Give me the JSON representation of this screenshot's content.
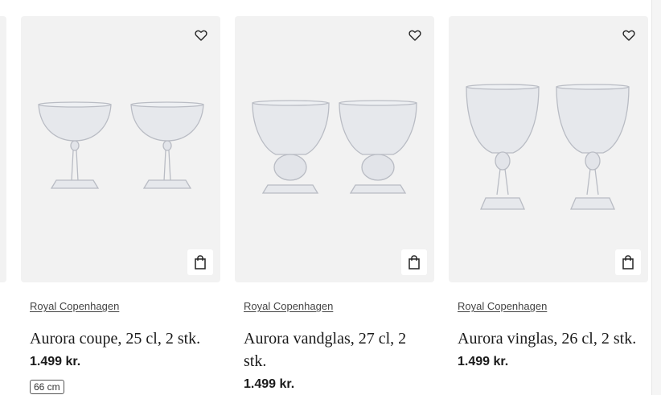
{
  "products": [
    {
      "brand": "Royal Copenhagen",
      "title": "Aurora coupe, 25 cl, 2 stk.",
      "price": "1.499 kr.",
      "size_tag": "66 cm",
      "image_icon": "coupe-glasses-image",
      "favorite_icon": "heart-icon",
      "cart_icon": "shopping-bag-icon"
    },
    {
      "brand": "Royal Copenhagen",
      "title": "Aurora vandglas, 27 cl, 2 stk.",
      "price": "1.499 kr.",
      "image_icon": "water-glasses-image",
      "favorite_icon": "heart-icon",
      "cart_icon": "shopping-bag-icon"
    },
    {
      "brand": "Royal Copenhagen",
      "title": "Aurora vinglas, 26 cl, 2 stk.",
      "price": "1.499 kr.",
      "image_icon": "wine-glasses-image",
      "favorite_icon": "heart-icon",
      "cart_icon": "shopping-bag-icon"
    }
  ],
  "colors": {
    "card_background": "#f2f2f2",
    "text": "#1a1a1a",
    "brand_text": "#444444"
  }
}
